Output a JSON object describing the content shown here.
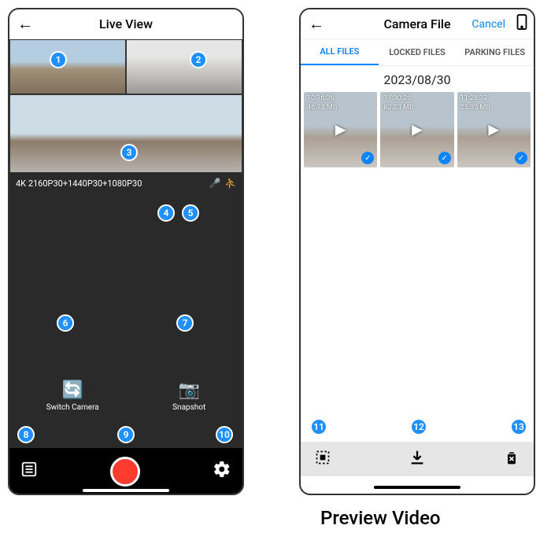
{
  "left": {
    "header": {
      "title": "Live View"
    },
    "resolution": "4K 2160P30+1440P30+1080P30",
    "actions": {
      "switch": "Switch Camera",
      "snapshot": "Snapshot"
    },
    "badges": [
      "1",
      "2",
      "3",
      "4",
      "5",
      "6",
      "7",
      "8",
      "9",
      "10"
    ]
  },
  "right": {
    "header": {
      "title": "Camera File",
      "cancel": "Cancel"
    },
    "tabs": {
      "all": "ALL FILES",
      "locked": "LOCKED FILES",
      "parking": "PARKING FILES"
    },
    "date": "2023/08/30",
    "thumbs": [
      {
        "time": "10:16:26",
        "size": "46.74 MB"
      },
      {
        "time": "17:30:26",
        "size": "82.23 MB"
      },
      {
        "time": "11:28:12",
        "size": "25.35 MB"
      }
    ],
    "badges": [
      "11",
      "12",
      "13"
    ]
  },
  "caption": "Preview Video"
}
